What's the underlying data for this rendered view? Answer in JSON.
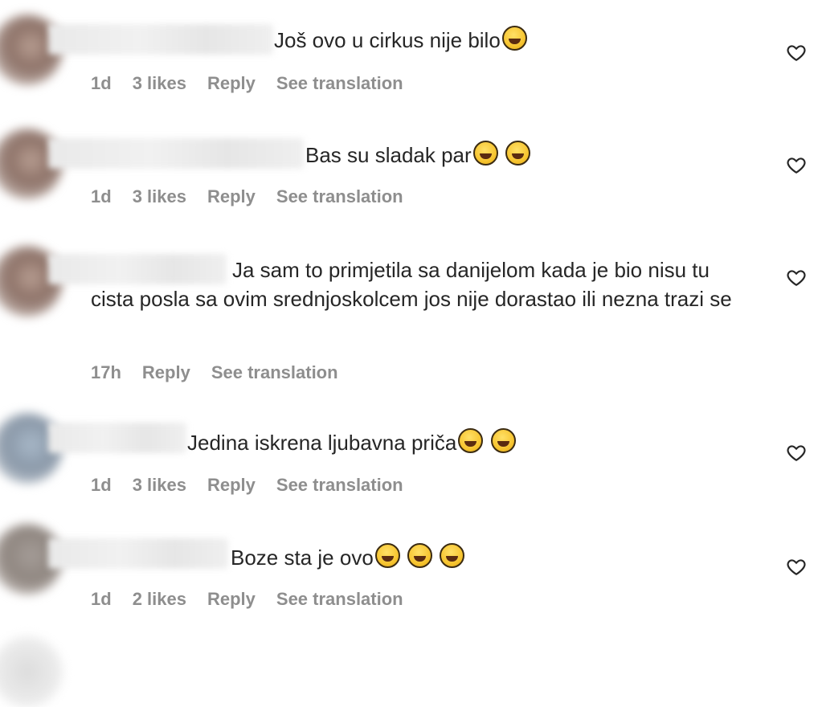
{
  "comments": [
    {
      "text": "Još ovo u cirkus nije bilo",
      "emojis": [
        "laughing-tears"
      ],
      "time": "1d",
      "likes": "3 likes",
      "reply": "Reply",
      "translate": "See translation"
    },
    {
      "text": "Bas su sladak par",
      "emojis": [
        "grinning",
        "grinning"
      ],
      "time": "1d",
      "likes": "3 likes",
      "reply": "Reply",
      "translate": "See translation"
    },
    {
      "text_line1": "Ja sam to primjetila sa danijelom kada je bio nisu",
      "text_rest": "tu cista posla sa ovim srednjoskolcem jos nije dorastao ili nezna trazi se",
      "emojis": [],
      "time": "17h",
      "reply": "Reply",
      "translate": "See translation"
    },
    {
      "text": "Jedina iskrena ljubavna priča",
      "emojis": [
        "laughing-tears",
        "laughing-tears"
      ],
      "time": "1d",
      "likes": "3 likes",
      "reply": "Reply",
      "translate": "See translation"
    },
    {
      "text": "Boze sta je ovo",
      "emojis": [
        "laughing-tears",
        "laughing-tears",
        "laughing-tears"
      ],
      "time": "1d",
      "likes": "2 likes",
      "reply": "Reply",
      "translate": "See translation"
    }
  ],
  "icons": {
    "like": "heart-outline-icon"
  },
  "colors": {
    "text": "#262626",
    "meta": "#8e8e8e",
    "background": "#ffffff"
  }
}
